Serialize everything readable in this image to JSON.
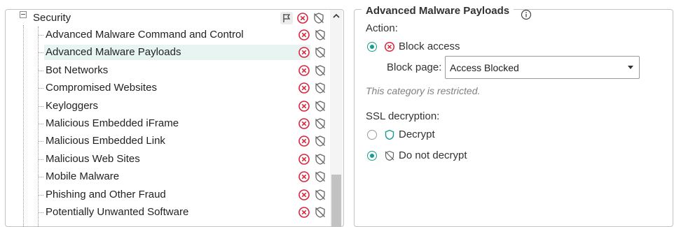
{
  "tree": {
    "root_label": "Security",
    "items": [
      {
        "label": "Advanced Malware Command and Control",
        "selected": false
      },
      {
        "label": "Advanced Malware Payloads",
        "selected": true
      },
      {
        "label": "Bot Networks",
        "selected": false
      },
      {
        "label": "Compromised Websites",
        "selected": false
      },
      {
        "label": "Keyloggers",
        "selected": false
      },
      {
        "label": "Malicious Embedded iFrame",
        "selected": false
      },
      {
        "label": "Malicious Embedded Link",
        "selected": false
      },
      {
        "label": "Malicious Web Sites",
        "selected": false
      },
      {
        "label": "Mobile Malware",
        "selected": false
      },
      {
        "label": "Phishing and Other Fraud",
        "selected": false
      },
      {
        "label": "Potentially Unwanted Software",
        "selected": false
      }
    ]
  },
  "details": {
    "title": "Advanced Malware Payloads",
    "action_label": "Action:",
    "block_access_label": "Block access",
    "block_page_label": "Block page:",
    "block_page_value": "Access Blocked",
    "restricted_note": "This category is restricted.",
    "ssl_label": "SSL decryption:",
    "decrypt_label": "Decrypt",
    "do_not_decrypt_label": "Do not decrypt",
    "ssl_selected": "do_not_decrypt",
    "action_selected": "block_access"
  },
  "colors": {
    "accent": "#1a9b8f",
    "block_red": "#d7263d",
    "selection_bg": "#e7f4f2",
    "icon_gray": "#666666"
  },
  "icons": [
    "flag-icon",
    "block-icon",
    "no-decrypt-icon",
    "scroll-up-icon",
    "info-icon",
    "shield-icon"
  ]
}
